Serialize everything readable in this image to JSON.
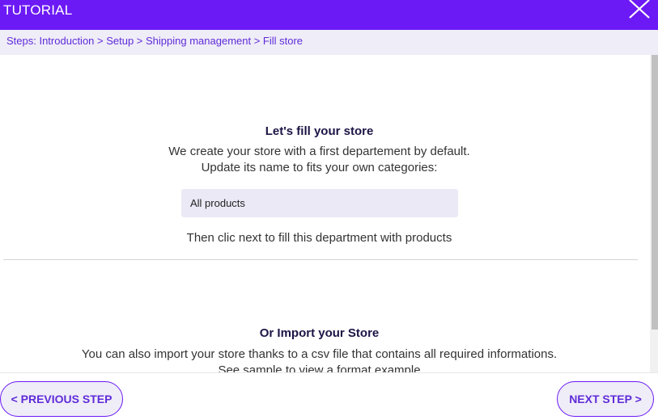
{
  "header": {
    "title": "TUTORIAL",
    "close_icon": "close-icon"
  },
  "breadcrumb": {
    "text": "Steps: Introduction > Setup > Shipping management > Fill store"
  },
  "fill_section": {
    "heading": "Let's fill your store",
    "line1": "We create your store with a first departement by default.",
    "line2": "Update its name to fits your own categories:",
    "department_value": "All products",
    "after_text": "Then clic next to fill this department with products"
  },
  "import_section": {
    "heading": "Or Import your Store",
    "line1": "You can also import your store thanks to a csv file that contains all required informations.",
    "line2": "See sample to view a format example"
  },
  "footer": {
    "prev_label": "< PREVIOUS STEP",
    "next_label": "NEXT STEP >"
  },
  "colors": {
    "accent": "#6b1af5",
    "breadcrumb_bg": "#efedf8",
    "link": "#5f2bd8"
  }
}
